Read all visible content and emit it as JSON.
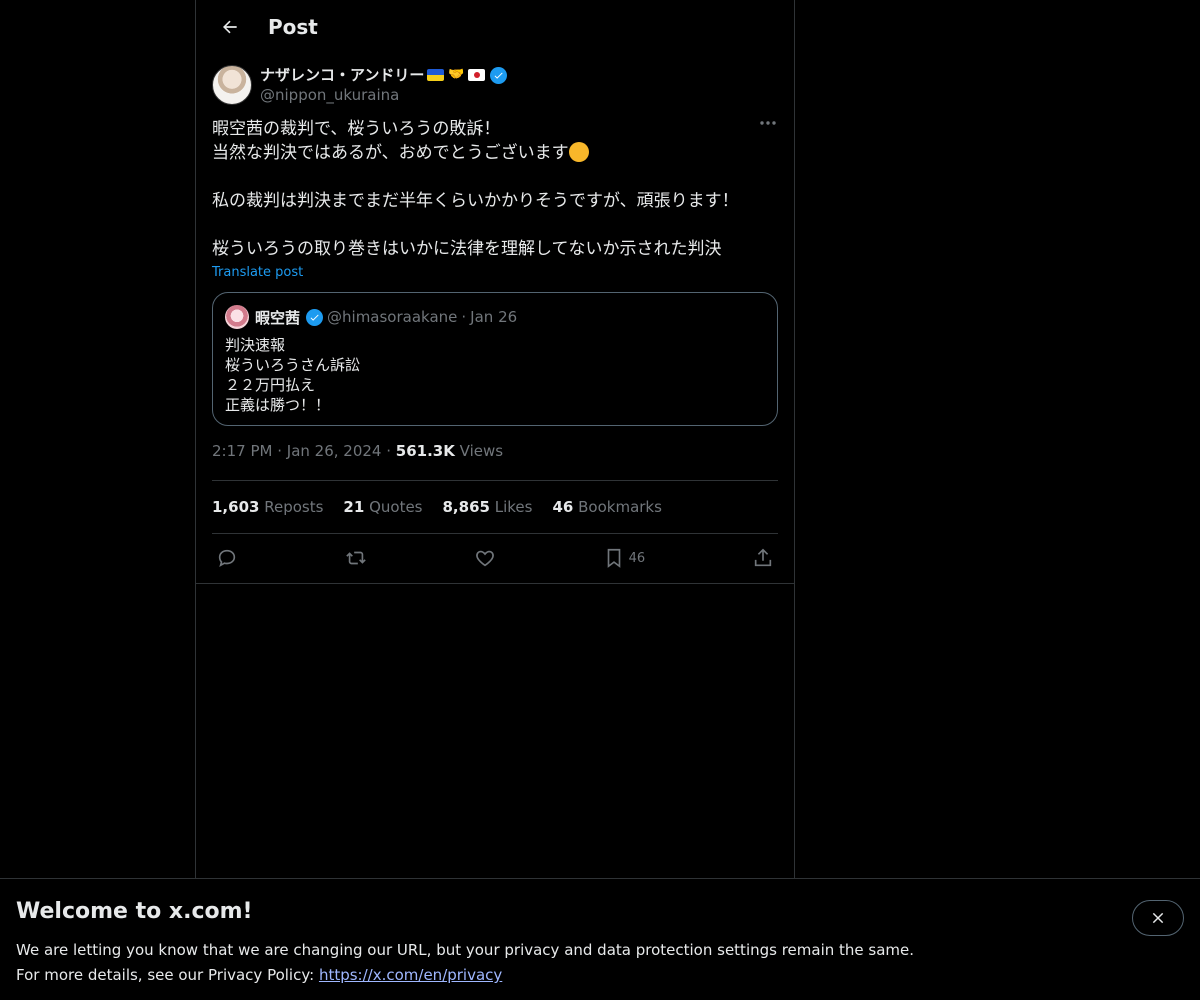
{
  "header": {
    "title": "Post"
  },
  "post": {
    "display_name": "ナザレンコ・アンドリー",
    "handle": "@nippon_ukuraina",
    "text_line1": "暇空茜の裁判で、桜ういろうの敗訴！",
    "text_line2": "当然な判決ではあるが、おめでとうございます",
    "text_para2": "私の裁判は判決までまだ半年くらいかかりそうですが、頑張ります！",
    "text_para3": "桜ういろうの取り巻きはいかに法律を理解してないか示された判決",
    "translate_label": "Translate post",
    "quote": {
      "display_name": "暇空茜",
      "handle": "@himasoraakane",
      "date": "Jan 26",
      "text": "判決速報\n桜ういろうさん訴訟\n２２万円払え\n正義は勝つ！！"
    },
    "meta": {
      "time": "2:17 PM",
      "date": "Jan 26, 2024",
      "views_count": "561.3K",
      "views_label": "Views"
    },
    "stats": {
      "reposts_count": "1,603",
      "reposts_label": "Reposts",
      "quotes_count": "21",
      "quotes_label": "Quotes",
      "likes_count": "8,865",
      "likes_label": "Likes",
      "bookmarks_count": "46",
      "bookmarks_label": "Bookmarks"
    },
    "actions": {
      "bookmark_count": "46"
    }
  },
  "banner": {
    "title": "Welcome to x.com!",
    "line1": "We are letting you know that we are changing our URL, but your privacy and data protection settings remain the same.",
    "line2_prefix": "For more details, see our Privacy Policy: ",
    "link": "https://x.com/en/privacy"
  },
  "colors": {
    "accent": "#1d9bf0",
    "muted": "#71767b",
    "border": "#2f3336",
    "background": "#000000"
  }
}
